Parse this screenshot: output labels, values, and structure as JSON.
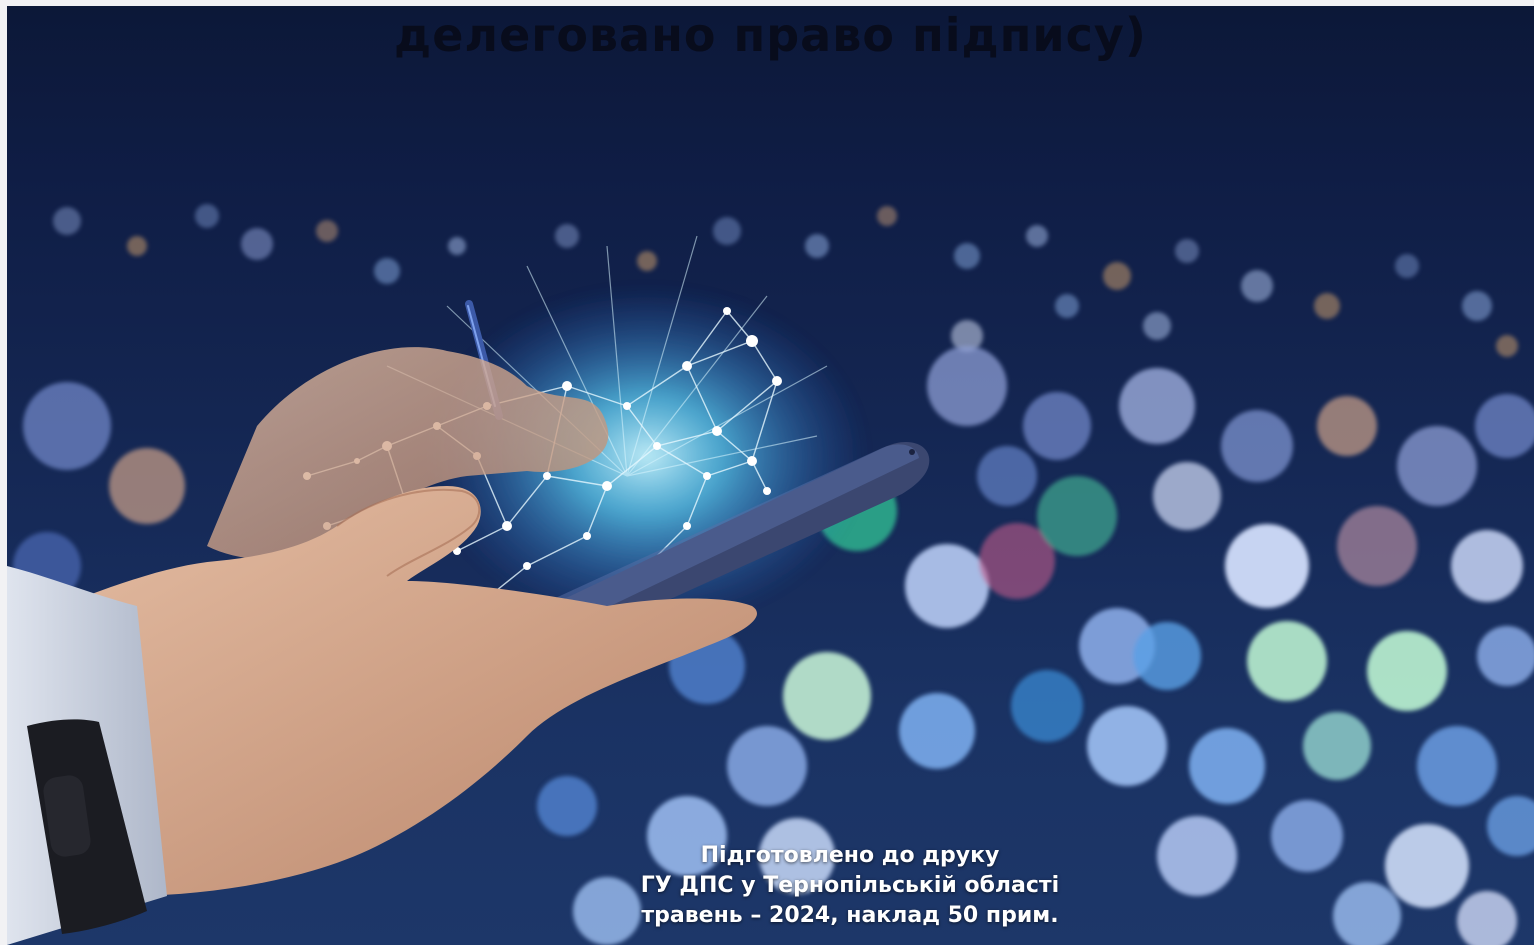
{
  "document": {
    "title": "делеговано право підпису)",
    "credit": {
      "line1": "Підготовлено до друку",
      "line2": "ГУ ДПС у Тернопільській області",
      "line3": "травень – 2024, наклад 50 прим."
    }
  },
  "illustration": {
    "subject": "hand-holding-smartphone-with-stylus",
    "colors": {
      "sky": "#0f1d45",
      "glow": "#5fd8ff",
      "skin": "#d8a98c",
      "phone": "#3b4770"
    }
  }
}
